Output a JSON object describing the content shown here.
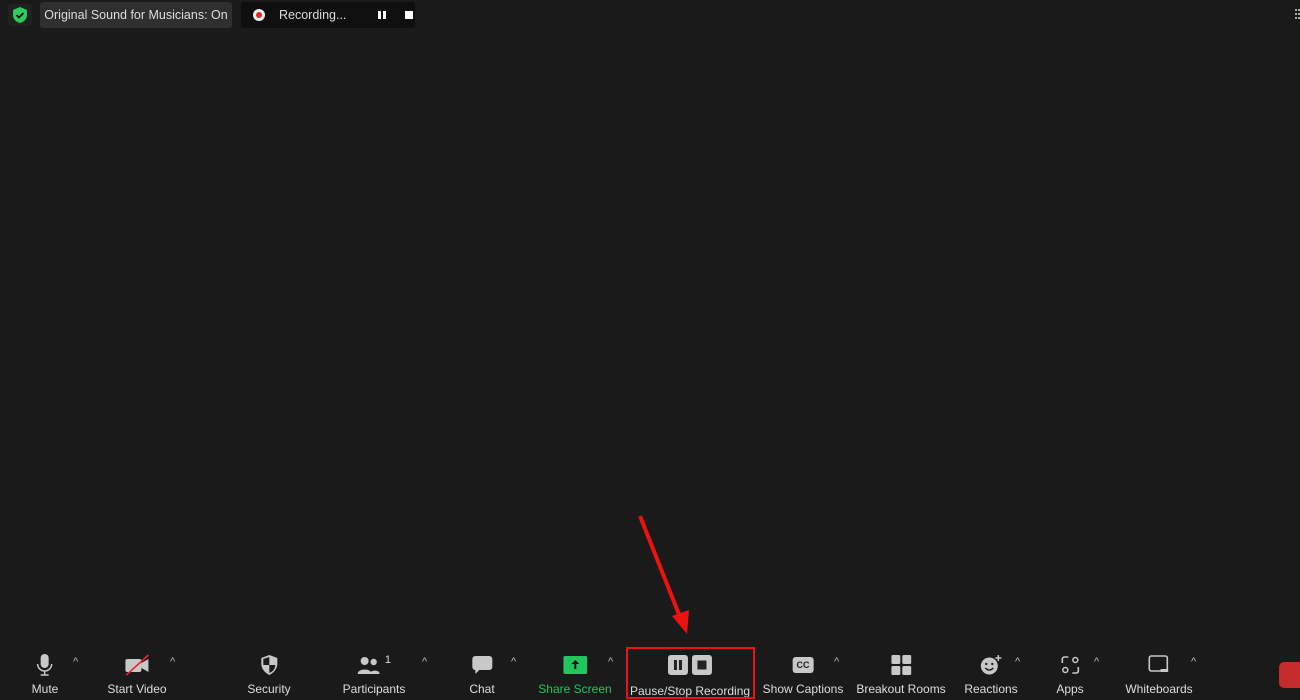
{
  "top_bar": {
    "security_icon": "shield-check-icon",
    "original_sound": "Original Sound for Musicians: On",
    "recording_status": "Recording...",
    "pause_icon": "pause-icon",
    "stop_icon": "stop-icon"
  },
  "toolbar": {
    "mute": "Mute",
    "start_video": "Start Video",
    "security": "Security",
    "participants": "Participants",
    "participants_count": "1",
    "chat": "Chat",
    "share_screen": "Share Screen",
    "pause_stop_recording": "Pause/Stop Recording",
    "show_captions": "Show Captions",
    "captions_icon_text": "CC",
    "breakout_rooms": "Breakout Rooms",
    "reactions": "Reactions",
    "apps": "Apps",
    "whiteboards": "Whiteboards"
  },
  "colors": {
    "background": "#1a1a1a",
    "share_green": "#22c55e",
    "annotation_red": "#ee1111",
    "end_red": "#c62a2a",
    "shield_green": "#2ecc5a"
  }
}
